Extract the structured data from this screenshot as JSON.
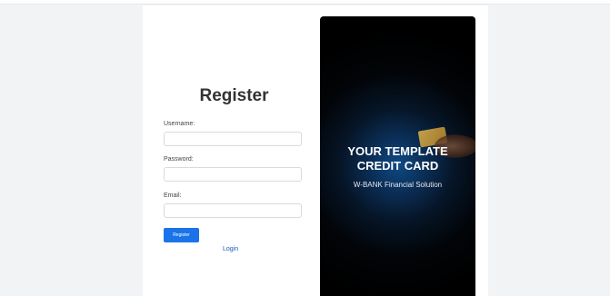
{
  "register": {
    "title": "Register",
    "username_label": "Username:",
    "username_value": "",
    "password_label": "Password:",
    "password_value": "",
    "email_label": "Email:",
    "email_value": "",
    "register_button": "Register",
    "login_link": "Login"
  },
  "hero": {
    "title_line1": "YOUR TEMPLATE",
    "title_line2": "CREDIT CARD",
    "subtitle": "W-BANK Financial Solution"
  },
  "colors": {
    "accent": "#1a73e8",
    "link": "#1a56b8",
    "hero_bg": "#000000",
    "hero_glow": "#0f4a86"
  },
  "icons": [
    "credit-card-icon",
    "hand-icon"
  ]
}
